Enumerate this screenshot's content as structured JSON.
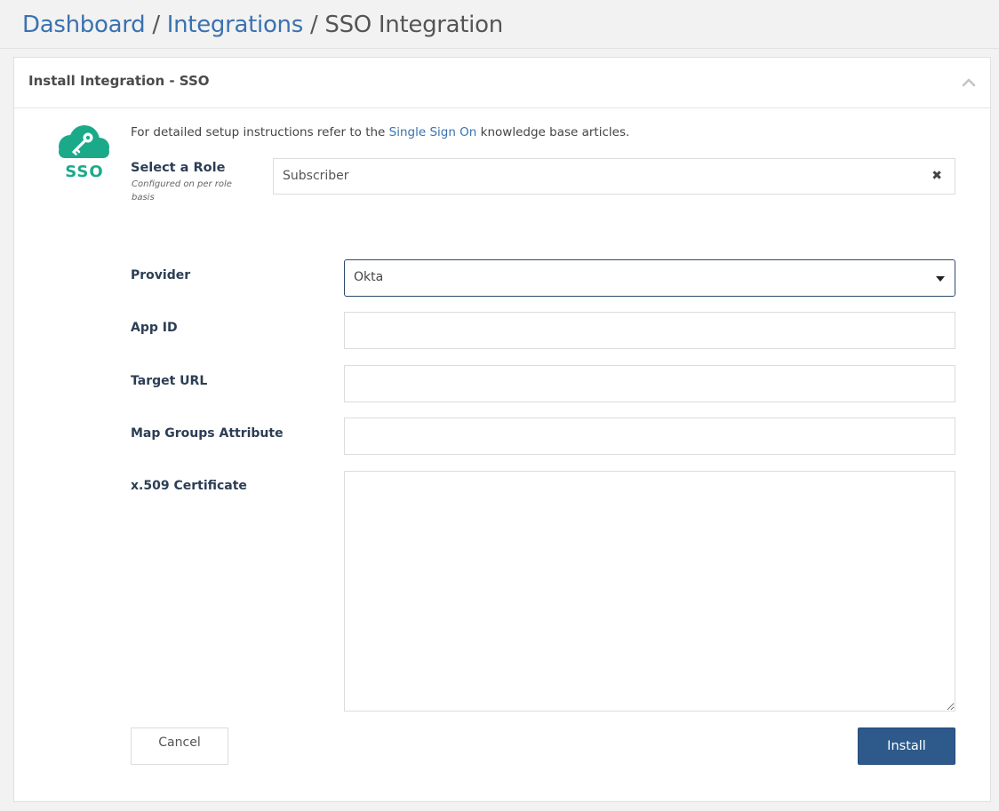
{
  "breadcrumb": {
    "items": [
      "Dashboard",
      "Integrations",
      "SSO Integration"
    ],
    "separator": "/"
  },
  "panel": {
    "title": "Install Integration - SSO",
    "collapse_icon": "chevron-up-icon"
  },
  "logo": {
    "text": "SSO",
    "color": "#1aaa8a",
    "icon": "cloud-key-icon"
  },
  "intro": {
    "before": "For detailed setup instructions refer to the",
    "link": "Single Sign On",
    "after": "knowledge base articles."
  },
  "role": {
    "label": "Select a Role",
    "hint": "Configured on per role basis",
    "value": "Subscriber",
    "clear_icon": "close-icon"
  },
  "fields": {
    "provider": {
      "label": "Provider",
      "value": "Okta"
    },
    "app_id": {
      "label": "App ID",
      "value": ""
    },
    "target_url": {
      "label": "Target URL",
      "value": ""
    },
    "map_groups": {
      "label": "Map Groups Attribute",
      "value": ""
    },
    "certificate": {
      "label": "x.509 Certificate",
      "value": ""
    }
  },
  "actions": {
    "cancel": "Cancel",
    "install": "Install"
  },
  "colors": {
    "link": "#3a72b0",
    "primary_button": "#2d5a8a",
    "label": "#2c3e55"
  }
}
